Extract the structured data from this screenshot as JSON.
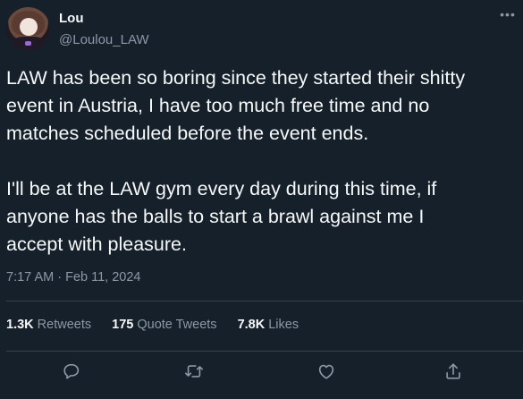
{
  "tweet": {
    "author": {
      "display_name": "Lou",
      "handle": "@Loulou_LAW"
    },
    "more_icon": "more-icon",
    "text": "LAW has been so boring since they started their shitty\nevent in Austria, I have too much free time and no\nmatches scheduled before the event ends.\n\nI'll be at the LAW gym every day during this time, if\nanyone has the balls to start a brawl against me I\naccept with pleasure.",
    "timestamp": "7:17 AM · Feb 11, 2024",
    "stats": {
      "retweets_count": "1.3K",
      "retweets_label": "Retweets",
      "quotes_count": "175",
      "quotes_label": "Quote Tweets",
      "likes_count": "7.8K",
      "likes_label": "Likes"
    },
    "actions": [
      "reply-icon",
      "retweet-icon",
      "like-icon",
      "share-icon"
    ]
  },
  "colors": {
    "background": "#15202b",
    "text_primary": "#f7f9f9",
    "text_secondary": "#8b98a5",
    "divider": "#38444d"
  }
}
